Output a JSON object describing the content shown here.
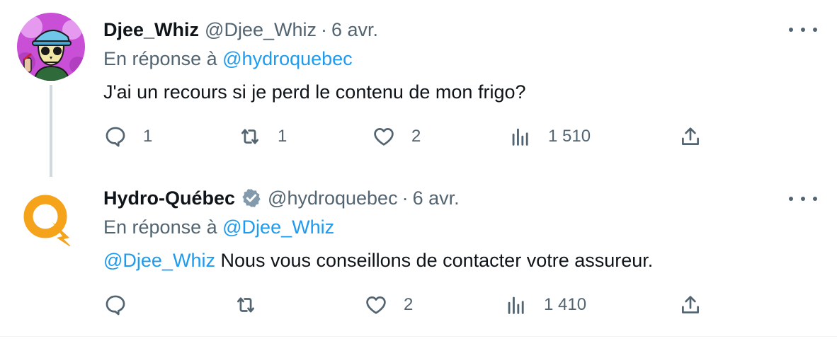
{
  "tweets": [
    {
      "name": "Djee_Whiz",
      "handle": "@Djee_Whiz",
      "separator": "·",
      "time": "6 avr.",
      "reply_prefix": "En réponse à",
      "reply_to": "@hydroquebec",
      "mention": "",
      "text": "J'ai un recours si je perd le contenu de mon frigo?",
      "verified": false,
      "avatar_icon": "cartoon-skull-avatar",
      "actions": {
        "reply": "1",
        "retweet": "1",
        "like": "2",
        "views": "1 510"
      }
    },
    {
      "name": "Hydro-Québec",
      "handle": "@hydroquebec",
      "separator": "·",
      "time": "6 avr.",
      "reply_prefix": "En réponse à",
      "reply_to": "@Djee_Whiz",
      "mention": "@Djee_Whiz",
      "text": " Nous vous conseillons de contacter votre assureur.",
      "verified": true,
      "avatar_icon": "hydro-quebec-logo",
      "actions": {
        "reply": "",
        "retweet": "",
        "like": "2",
        "views": "1 410"
      }
    }
  ],
  "colors": {
    "link": "#1d9bf0",
    "secondary": "#536471",
    "primary": "#0f1419",
    "brand_orange": "#f5a31a"
  }
}
